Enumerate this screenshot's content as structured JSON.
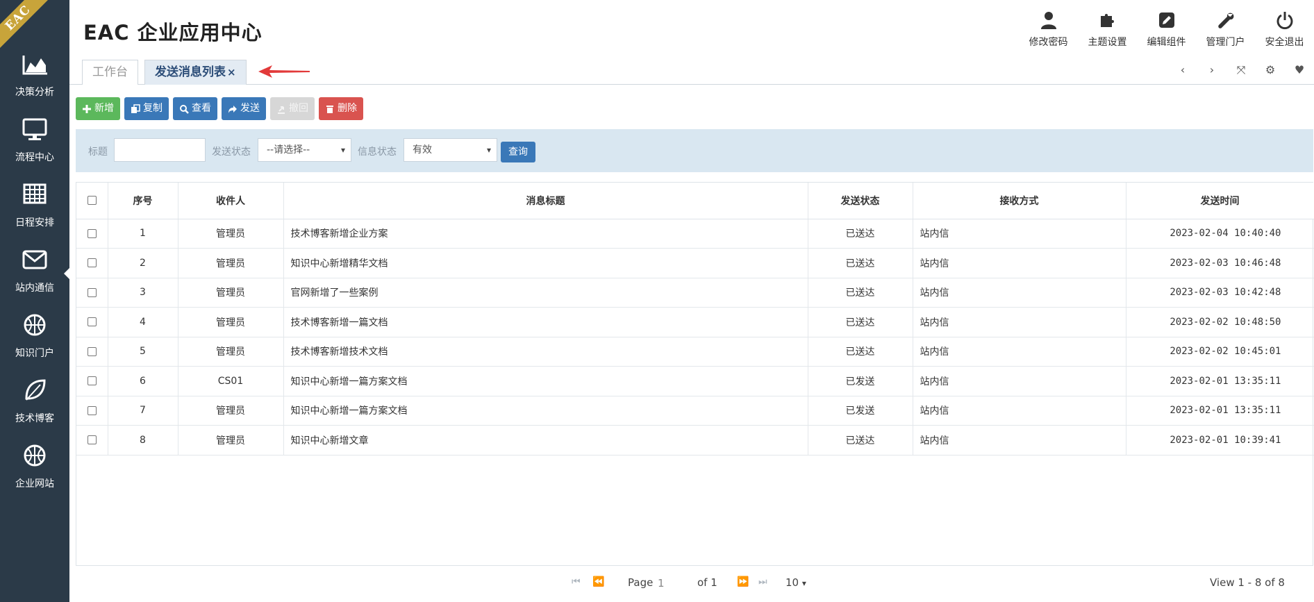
{
  "brand": {
    "ribbon": "EAC"
  },
  "header": {
    "title": "EAC 企业应用中心"
  },
  "sidebar": {
    "items": [
      {
        "label": "决策分析",
        "icon": "chart-area-icon"
      },
      {
        "label": "流程中心",
        "icon": "monitor-icon"
      },
      {
        "label": "日程安排",
        "icon": "calendar-grid-icon"
      },
      {
        "label": "站内通信",
        "icon": "envelope-icon",
        "active": true
      },
      {
        "label": "知识门户",
        "icon": "basketball-icon"
      },
      {
        "label": "技术博客",
        "icon": "leaf-icon"
      },
      {
        "label": "企业网站",
        "icon": "basketball-icon"
      }
    ]
  },
  "top_actions": [
    {
      "label": "修改密码",
      "icon": "user-icon"
    },
    {
      "label": "主题设置",
      "icon": "puzzle-icon"
    },
    {
      "label": "编辑组件",
      "icon": "edit-icon"
    },
    {
      "label": "管理门户",
      "icon": "wrench-icon"
    },
    {
      "label": "安全退出",
      "icon": "power-icon"
    }
  ],
  "tabs": [
    {
      "label": "工作台",
      "active": false
    },
    {
      "label": "发送消息列表",
      "active": true,
      "close": "×"
    }
  ],
  "toolbar": {
    "new_label": "新增",
    "copy_label": "复制",
    "view_label": "查看",
    "send_label": "发送",
    "recall_label": "撤回",
    "delete_label": "删除"
  },
  "search": {
    "title_label": "标题",
    "title_value": "",
    "send_status_label": "发送状态",
    "send_status_value": "--请选择--",
    "info_status_label": "信息状态",
    "info_status_value": "有效",
    "query_label": "查询"
  },
  "table": {
    "columns": [
      "序号",
      "收件人",
      "消息标题",
      "发送状态",
      "接收方式",
      "发送时间"
    ],
    "rows": [
      {
        "no": "1",
        "recipient": "管理员",
        "title": "技术博客新增企业方案",
        "status": "已送达",
        "method": "站内信",
        "time": "2023-02-04 10:40:40"
      },
      {
        "no": "2",
        "recipient": "管理员",
        "title": "知识中心新增精华文档",
        "status": "已送达",
        "method": "站内信",
        "time": "2023-02-03 10:46:48"
      },
      {
        "no": "3",
        "recipient": "管理员",
        "title": "官网新增了一些案例",
        "status": "已送达",
        "method": "站内信",
        "time": "2023-02-03 10:42:48"
      },
      {
        "no": "4",
        "recipient": "管理员",
        "title": "技术博客新增一篇文档",
        "status": "已送达",
        "method": "站内信",
        "time": "2023-02-02 10:48:50"
      },
      {
        "no": "5",
        "recipient": "管理员",
        "title": "技术博客新增技术文档",
        "status": "已送达",
        "method": "站内信",
        "time": "2023-02-02 10:45:01"
      },
      {
        "no": "6",
        "recipient": "CS01",
        "title": "知识中心新增一篇方案文档",
        "status": "已发送",
        "method": "站内信",
        "time": "2023-02-01 13:35:11"
      },
      {
        "no": "7",
        "recipient": "管理员",
        "title": "知识中心新增一篇方案文档",
        "status": "已发送",
        "method": "站内信",
        "time": "2023-02-01 13:35:11"
      },
      {
        "no": "8",
        "recipient": "管理员",
        "title": "知识中心新增文章",
        "status": "已送达",
        "method": "站内信",
        "time": "2023-02-01 10:39:41"
      }
    ]
  },
  "pager": {
    "page_label": "Page",
    "page_value": "1",
    "of_label": "of 1",
    "page_size": "10",
    "summary": "View 1 - 8 of 8"
  },
  "colors": {
    "sidebar_bg": "#2b3a48",
    "accent_blue": "#3a78b8",
    "new_green": "#5cb85c",
    "delete_red": "#d9534f",
    "search_panel_bg": "#d9e7f1"
  }
}
